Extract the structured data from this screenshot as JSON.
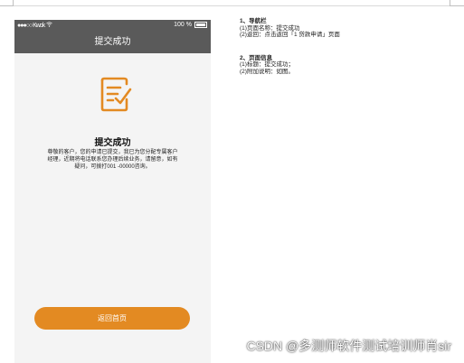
{
  "status_bar": {
    "carrier": "●●●○○ Kwok",
    "wifi": "wifi",
    "battery": "100 %"
  },
  "nav": {
    "title": "提交成功"
  },
  "content": {
    "icon": "document-check-icon",
    "title": "提交成功",
    "desc_lines": [
      "尊敬的客户，您的申请已提交，我已为您分配专属客户",
      "经理，近期将电话联系您办理后续业务，请留意，如有",
      "疑问，可拨打001 -00000咨询。"
    ]
  },
  "button": {
    "label": "返回首页"
  },
  "notes": [
    {
      "heading": "1、导航栏",
      "lines": [
        "(1)页面名称：提交成功",
        "(2)返回：点击返回「1 贷款申请」页面"
      ]
    },
    {
      "heading": "2、页面信息",
      "lines": [
        "(1)标题：提交成功；",
        "(2)附加说明：如图。"
      ]
    }
  ],
  "watermark": "CSDN @多测师软件测试培训师肖sir",
  "colors": {
    "accent": "#e38a22",
    "navbar": "#5a5a5a"
  }
}
